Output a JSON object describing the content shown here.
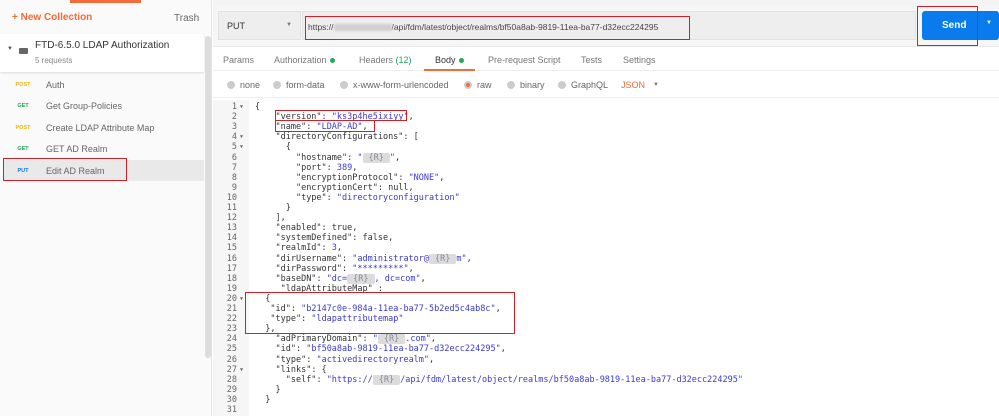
{
  "sidebar": {
    "new_collection": "+ New Collection",
    "trash": "Trash",
    "collection": {
      "name": "FTD-6.5.0 LDAP Authorization",
      "count": "5 requests"
    },
    "requests": [
      {
        "method": "POST",
        "name": "Auth",
        "color": "#f2b50f"
      },
      {
        "method": "GET",
        "name": "Get Group-Policies",
        "color": "#26a65b"
      },
      {
        "method": "POST",
        "name": "Create LDAP Attribute Map",
        "color": "#f2b50f"
      },
      {
        "method": "GET",
        "name": "GET AD Realm",
        "color": "#26a65b"
      },
      {
        "method": "PUT",
        "name": "Edit AD Realm",
        "color": "#097bed",
        "active": true
      }
    ]
  },
  "request": {
    "method": "PUT",
    "url_prefix": "https://",
    "url_suffix": "/api/fdm/latest/object/realms/bf50a8ab-9819-11ea-ba77-d32ecc224295",
    "send": "Send"
  },
  "tabs": [
    {
      "label": "Params"
    },
    {
      "label": "Authorization"
    },
    {
      "label": "Headers",
      "badge": "(12)"
    },
    {
      "label": "Body",
      "active": true
    },
    {
      "label": "Pre-request Script"
    },
    {
      "label": "Tests"
    },
    {
      "label": "Settings"
    }
  ],
  "body_options": [
    "none",
    "form-data",
    "x-www-form-urlencoded",
    "raw",
    "binary",
    "GraphQL"
  ],
  "body_format": "JSON",
  "editor": {
    "lines": [
      "{",
      "    \"version\": \"ks3p4he5ixiyy\",",
      "    \"name\": \"LDAP-AD\",",
      "    \"directoryConfigurations\": [",
      "      {",
      "        \"hostname\": \"{R}\",",
      "        \"port\": 389,",
      "        \"encryptionProtocol\": \"NONE\",",
      "        \"encryptionCert\": null,",
      "        \"type\": \"directoryconfiguration\"",
      "      }",
      "    ],",
      "    \"enabled\": true,",
      "    \"systemDefined\": false,",
      "    \"realmId\": 3,",
      "    \"dirUsername\": \"administrator@{R}m\",",
      "    \"dirPassword\": \"*********\",",
      "    \"baseDN\": \"dc={R}, dc=com\",",
      "     \"ldapAttributeMap\" :",
      "  {",
      "   \"id\": \"b2147c0e-984a-11ea-ba77-5b2ed5c4ab8c\",",
      "   \"type\": \"ldapattributemap\"",
      "  },",
      "    \"adPrimaryDomain\": \"{R}.com\",",
      "    \"id\": \"bf50a8ab-9819-11ea-ba77-d32ecc224295\",",
      "    \"type\": \"activedirectoryrealm\",",
      "    \"links\": {",
      "      \"self\": \"https://{R}/api/fdm/latest/object/realms/bf50a8ab-9819-11ea-ba77-d32ecc224295\"",
      "    }",
      "  }",
      ""
    ],
    "folds": [
      1,
      4,
      5,
      20,
      27
    ]
  }
}
